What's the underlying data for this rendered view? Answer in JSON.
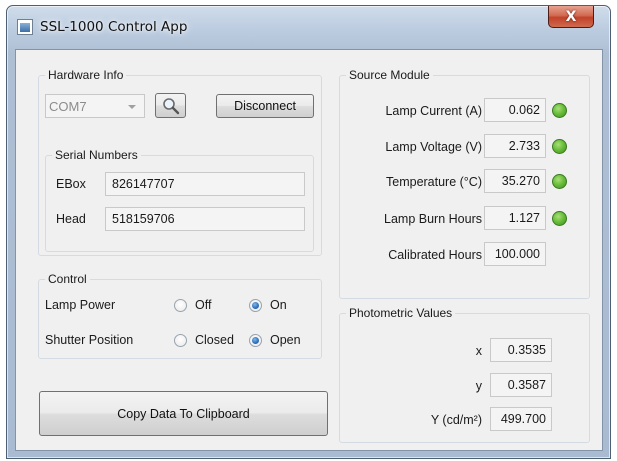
{
  "window": {
    "title": "SSL-1000 Control App",
    "close_glyph": "X",
    "icon": "app-icon"
  },
  "hardware_info": {
    "group_label": "Hardware Info",
    "port_value": "COM7",
    "search_icon": "search-icon",
    "disconnect_label": "Disconnect",
    "serial_numbers": {
      "group_label": "Serial Numbers",
      "ebox_label": "EBox",
      "ebox_value": "826147707",
      "head_label": "Head",
      "head_value": "518159706"
    }
  },
  "control": {
    "group_label": "Control",
    "lamp_power": {
      "label": "Lamp Power",
      "off": "Off",
      "on": "On",
      "selected": "On"
    },
    "shutter_position": {
      "label": "Shutter Position",
      "closed": "Closed",
      "open": "Open",
      "selected": "Open"
    }
  },
  "copy_button_label": "Copy Data To Clipboard",
  "source_module": {
    "group_label": "Source Module",
    "rows": [
      {
        "label": "Lamp Current (A)",
        "value": "0.062",
        "status_color": "#5cb531"
      },
      {
        "label": "Lamp Voltage (V)",
        "value": "2.733",
        "status_color": "#5cb531"
      },
      {
        "label": "Temperature (°C)",
        "value": "35.270",
        "status_color": "#5cb531"
      },
      {
        "label": "Lamp Burn Hours",
        "value": "1.127",
        "status_color": "#5cb531"
      },
      {
        "label": "Calibrated Hours",
        "value": "100.000"
      }
    ]
  },
  "photometric": {
    "group_label": "Photometric Values",
    "rows": [
      {
        "label": "x",
        "value": "0.3535"
      },
      {
        "label": "y",
        "value": "0.3587"
      },
      {
        "label": "Y (cd/m²)",
        "value": "499.700"
      }
    ]
  }
}
